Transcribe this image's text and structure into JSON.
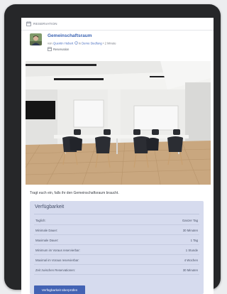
{
  "header": {
    "section_label": "RESERVATION"
  },
  "post": {
    "title": "Gemeinschaftsraum",
    "meta_prefix": "von",
    "author": "Quentin Hebert",
    "meta_in": "in",
    "space": "Demo Siedlung",
    "meta_time": "• 2 Minute",
    "tag": "Reservation"
  },
  "description": "Tragt euch ein, falls ihr den Gemeinschaftsraum braucht.",
  "availability": {
    "title": "Verfügbarkeit",
    "rows": [
      {
        "label": "Taglich:",
        "value": "Ganzer Tag"
      },
      {
        "label": "Minimale Dauer:",
        "value": "30 Minuten"
      },
      {
        "label": "Maximale Dauer:",
        "value": "1 Tag"
      },
      {
        "label": "Minimum im Voraus reservierbar:",
        "value": "1 Stunde"
      },
      {
        "label": "Maximal im Voraus reservierbar:",
        "value": "4 Wochen"
      },
      {
        "label": "Zeit zwischen Reservationen:",
        "value": "30 Minuten"
      }
    ],
    "button_label": "Verfügbarkeit überprüfen"
  },
  "icons": {
    "section": "calendar-icon",
    "verified": "check-badge-icon",
    "tag": "calendar-icon"
  }
}
